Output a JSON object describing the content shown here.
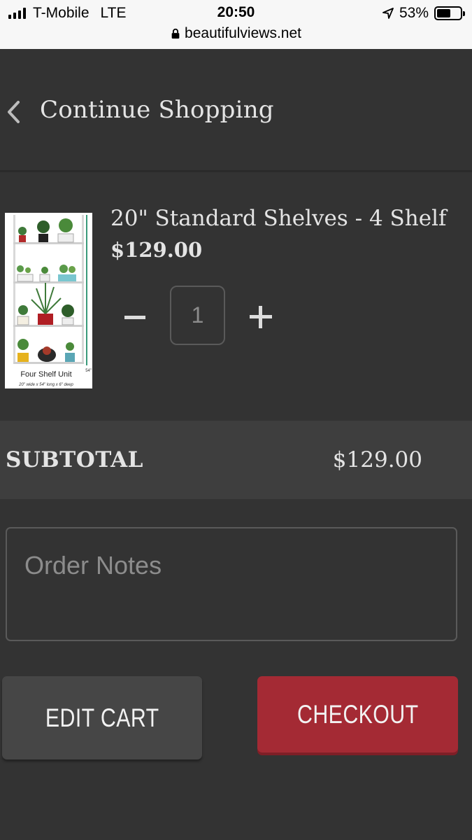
{
  "status_bar": {
    "carrier": "T-Mobile",
    "network": "LTE",
    "time": "20:50",
    "battery_percent": "53%",
    "battery_level": 0.53,
    "url": "beautifulviews.net"
  },
  "nav": {
    "continue_label": "Continue Shopping"
  },
  "cart": {
    "item": {
      "title": "20\" Standard Shelves - 4 Shelf",
      "price": "$129.00",
      "quantity": "1",
      "image_caption": "Four Shelf Unit",
      "image_subcaption": "20\" wide x 54\" long x 6\" deep",
      "image_dimension": "54\""
    },
    "subtotal_label": "SUBTOTAL",
    "subtotal_value": "$129.00"
  },
  "order_notes": {
    "placeholder": "Order Notes",
    "value": ""
  },
  "buttons": {
    "edit_cart": "EDIT CART",
    "checkout": "CHECKOUT"
  },
  "colors": {
    "background": "#333333",
    "subtotal_background": "#3e3e3e",
    "checkout_red": "#a42a34",
    "edit_cart_gray": "#464646"
  }
}
